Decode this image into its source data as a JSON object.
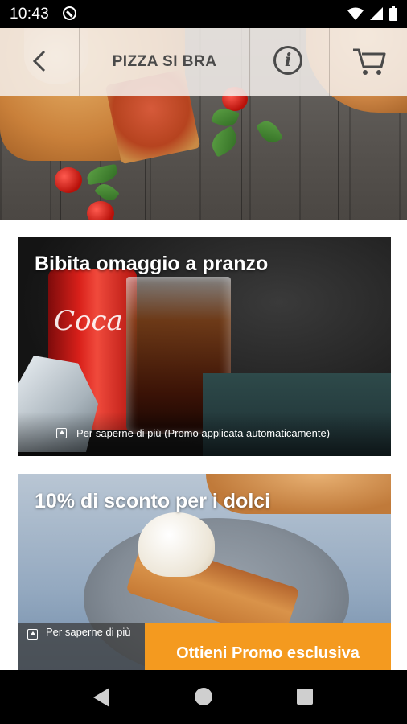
{
  "status_bar": {
    "time": "10:43",
    "icons": [
      "do-not-disturb-icon",
      "wifi-icon",
      "signal-icon",
      "battery-icon"
    ]
  },
  "header": {
    "title": "PIZZA SI BRA",
    "back_icon": "chevron-left-icon",
    "info_icon": "info-icon",
    "info_glyph": "i",
    "cart_icon": "cart-icon"
  },
  "promos": [
    {
      "title": "Bibita omaggio a pranzo",
      "info_text": "Per saperne di più (Promo applicata automaticamente)"
    },
    {
      "title": "10% di sconto per i dolci",
      "info_text": "Per saperne di più",
      "cta_label": "Ottieni Promo esclusiva"
    }
  ],
  "colors": {
    "accent": "#f49a1f",
    "header_text": "#4a4a4a"
  },
  "nav": {
    "icons": [
      "back-triangle-icon",
      "home-circle-icon",
      "recents-square-icon"
    ]
  }
}
